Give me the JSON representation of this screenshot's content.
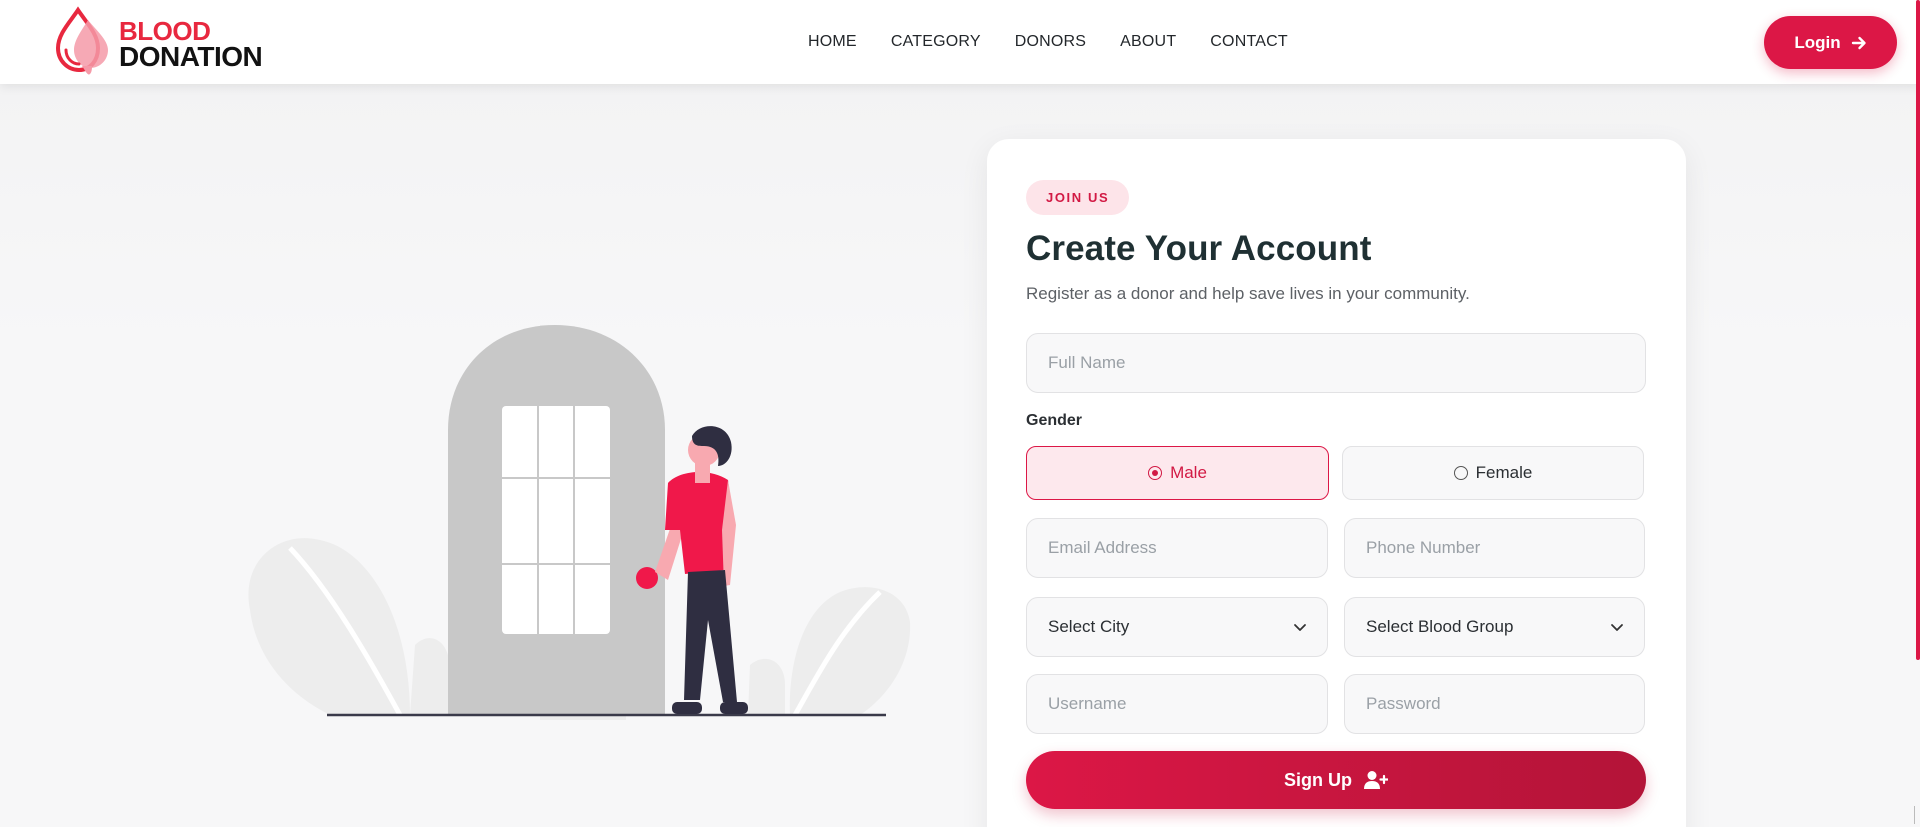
{
  "brand": {
    "line1": "BLOOD",
    "line2": "DONATION",
    "accent_color": "#e8283f",
    "primary_color": "#dc1746"
  },
  "nav": {
    "items": [
      "HOME",
      "CATEGORY",
      "DONORS",
      "ABOUT",
      "CONTACT"
    ]
  },
  "header": {
    "login_label": "Login",
    "login_icon": "arrow-right-icon"
  },
  "illustration": {
    "description_icon": "person-at-door-icon",
    "shirt_color": "#f0184a",
    "door_color": "#c8c8c8"
  },
  "form": {
    "badge": "JOIN US",
    "title": "Create Your Account",
    "subtitle": "Register as a donor and help save lives in your community.",
    "full_name_placeholder": "Full Name",
    "gender_label": "Gender",
    "gender_options": [
      "Male",
      "Female"
    ],
    "gender_selected": "Male",
    "email_placeholder": "Email Address",
    "phone_placeholder": "Phone Number",
    "city_select": "Select City",
    "blood_group_select": "Select Blood Group",
    "username_placeholder": "Username",
    "password_placeholder": "Password",
    "submit_label": "Sign Up",
    "submit_icon": "user-plus-icon"
  }
}
